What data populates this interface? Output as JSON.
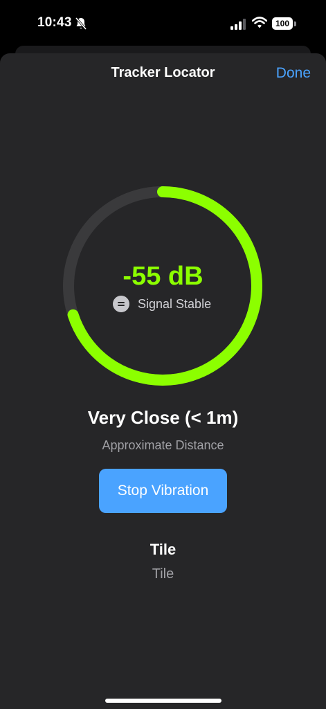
{
  "status_bar": {
    "time": "10:43",
    "battery": "100",
    "icons": [
      "bell-slash-icon",
      "cellular-signal-icon",
      "wifi-icon",
      "battery-icon"
    ]
  },
  "nav": {
    "title": "Tracker Locator",
    "done_label": "Done"
  },
  "signal": {
    "value": "-55 dB",
    "status": "Signal Stable",
    "status_icon": "equal-icon",
    "strength_fraction": 0.7
  },
  "distance": {
    "label": "Very Close (< 1m)",
    "subtitle": "Approximate Distance"
  },
  "actions": {
    "stop_vibration_label": "Stop Vibration"
  },
  "device": {
    "name": "Tile",
    "type": "Tile"
  },
  "colors": {
    "accent_green": "#8cff00",
    "accent_blue": "#4aa3ff",
    "sheet_bg": "#262628",
    "ring_track": "#3a3a3c"
  }
}
